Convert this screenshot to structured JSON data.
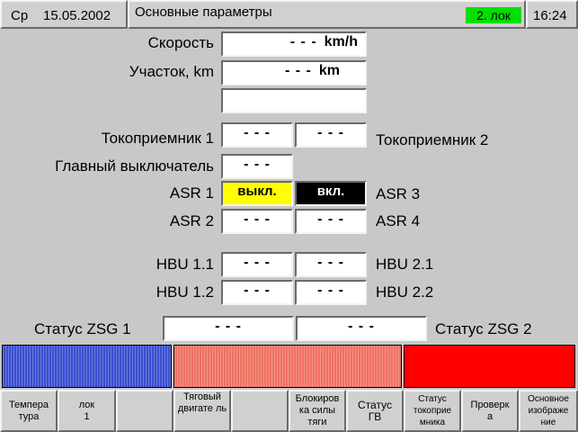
{
  "header": {
    "day": "Ср",
    "date": "15.05.2002",
    "title": "Основные параметры",
    "loco_badge": "2. лок",
    "time": "16:24"
  },
  "params": {
    "speed": {
      "label": "Скорость",
      "value": "- - -",
      "unit": "km/h"
    },
    "section": {
      "label": "Участок, km",
      "value": "- - -",
      "unit": "km"
    },
    "blank": {
      "value": ""
    },
    "pantograph1": {
      "label": "Токоприемник 1",
      "value": "- - -"
    },
    "pantograph2": {
      "label": "Токоприемник 2",
      "value": "- - -"
    },
    "main_switch": {
      "label": "Главный выключатель",
      "value": "- - -"
    },
    "asr1": {
      "label": "ASR 1",
      "value": "выкл."
    },
    "asr3": {
      "label": "ASR 3",
      "value": "вкл."
    },
    "asr2": {
      "label": "ASR 2",
      "value": "- - -"
    },
    "asr4": {
      "label": "ASR 4",
      "value": "- - -"
    },
    "hbu11": {
      "label": "HBU 1.1",
      "value": "- - -"
    },
    "hbu21": {
      "label": "HBU 2.1",
      "value": "- - -"
    },
    "hbu12": {
      "label": "HBU 1.2",
      "value": "- - -"
    },
    "hbu22": {
      "label": "HBU 2.2",
      "value": "- - -"
    },
    "zsg1": {
      "label": "Статус ZSG 1",
      "value": "- - -"
    },
    "zsg2": {
      "label": "Статус ZSG 2",
      "value": "- - -"
    }
  },
  "colors": {
    "badge_green": "#00e000",
    "asr_yellow": "#ffff00",
    "asr_black": "#000000",
    "bar_blue": "#3a4fd0",
    "bar_salmon": "#f07060",
    "bar_red": "#ff0000"
  },
  "softkeys": [
    {
      "name": "softkey-temperature",
      "label": "Темпера тура"
    },
    {
      "name": "softkey-loco1",
      "label": "лок 1"
    },
    {
      "name": "softkey-empty-3",
      "label": ""
    },
    {
      "name": "softkey-traction-motor",
      "label": "Тяговый двигате ль"
    },
    {
      "name": "softkey-empty-5",
      "label": ""
    },
    {
      "name": "softkey-traction-block",
      "label": "Блокиров ка силы тяги"
    },
    {
      "name": "softkey-status-gv",
      "label": "Статус ГВ"
    },
    {
      "name": "softkey-pantograph-status",
      "label": "Статус токоприе мника"
    },
    {
      "name": "softkey-check",
      "label": "Проверк а"
    },
    {
      "name": "softkey-main-image",
      "label": "Основное изображе ние"
    }
  ]
}
